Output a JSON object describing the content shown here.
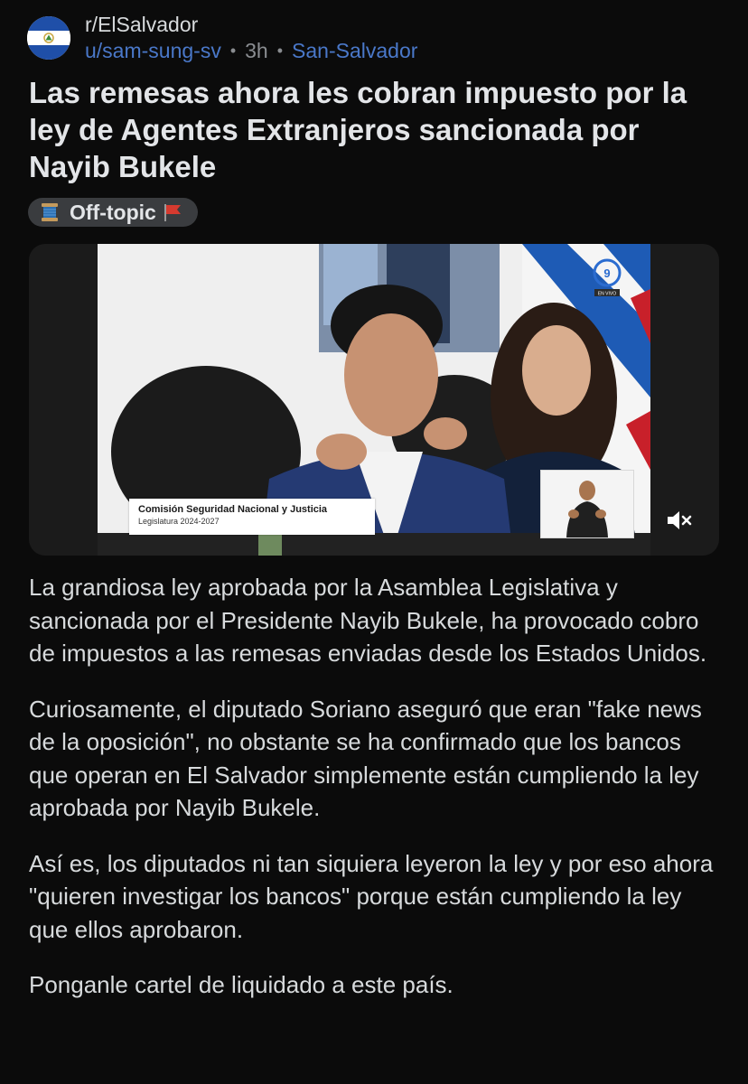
{
  "header": {
    "subreddit": "r/ElSalvador",
    "username": "u/sam-sung-sv",
    "separator": "•",
    "time": "3h",
    "user_flair": "San-Salvador",
    "avatar_icon": "el-salvador-flag-icon"
  },
  "post": {
    "title": "Las remesas ahora les cobran impuesto por la ley de Agentes Extranjeros sancionada por Nayib Bukele",
    "flair": {
      "label": "Off-topic",
      "leading_icon": "spool-of-thread-icon",
      "trailing_icon": "red-flag-icon"
    },
    "video": {
      "lower_third_title": "Comisión Seguridad Nacional y Justicia",
      "lower_third_subtitle": "Legislatura 2024-2027",
      "badge_text": "EN VIVO",
      "mute_icon": "muted-speaker-icon"
    },
    "paragraphs": [
      "La grandiosa ley aprobada por la Asamblea Legislativa y sancionada por el Presidente Nayib Bukele, ha provocado cobro de impuestos a las remesas enviadas desde los Estados Unidos.",
      "Curiosamente, el diputado Soriano aseguró que eran \"fake news de la oposición\", no obstante se ha confirmado que los bancos que operan en El Salvador simplemente están cumpliendo la ley aprobada por Nayib Bukele.",
      "Así es, los diputados ni tan siquiera leyeron la ley y por eso ahora \"quieren investigar los bancos\" porque están cumpliendo la ley que ellos aprobaron.",
      "Ponganle cartel de liquidado a este país."
    ]
  },
  "colors": {
    "background": "#0b0b0b",
    "link_blue": "#4a78c9",
    "flair_bg": "#3a3c3f",
    "text": "#d7dadc"
  }
}
